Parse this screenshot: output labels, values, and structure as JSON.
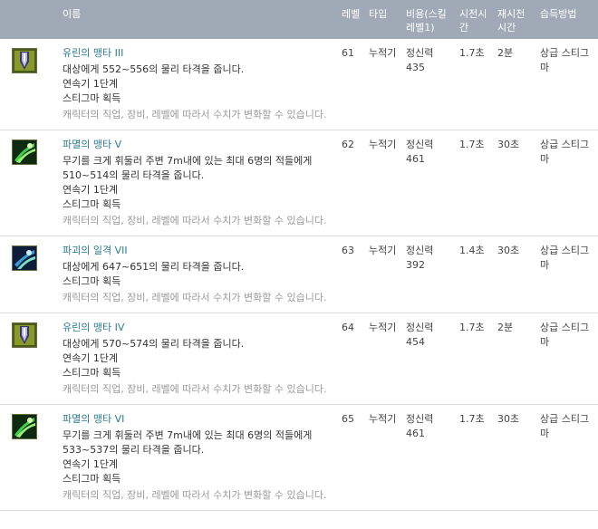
{
  "headers": {
    "name": "이름",
    "level": "레벨",
    "type": "타입",
    "cost": "비용(스킬 레벨1)",
    "cast": "시전시간",
    "cooldown": "재시전시간",
    "learn": "습득방법"
  },
  "colors": {
    "header_bg": "#a0a9b6",
    "skill_name": "#2c7a8e",
    "note": "#9a9a9a"
  },
  "skills": [
    {
      "icon": "lance-strike-icon",
      "name": "유린의 맹타 III",
      "lines": [
        "대상에게 552~556의 물리 타격을 줍니다.",
        "연속기 1단계",
        "스티그마 획득"
      ],
      "note": "캐릭터의 직업, 장비, 레벨에 따라서 수치가 변화할 수 있습니다.",
      "level": "61",
      "type": "누적기",
      "cost": "정신력 435",
      "cast": "1.7초",
      "cooldown": "2분",
      "learn": "상급 스티그마"
    },
    {
      "icon": "green-slash-icon",
      "name": "파멸의 맹타 V",
      "lines": [
        "무기를 크게 휘둘러 주변 7m내에 있는 최대 6명의 적들에게 510~514의 물리 타격을 줍니다.",
        "연속기 1단계",
        "스티그마 획득"
      ],
      "note": "캐릭터의 직업, 장비, 레벨에 따라서 수치가 변화할 수 있습니다.",
      "level": "62",
      "type": "누적기",
      "cost": "정신력 461",
      "cast": "1.7초",
      "cooldown": "30초",
      "learn": "상급 스티그마"
    },
    {
      "icon": "blue-slash-icon",
      "name": "파괴의 일격 VII",
      "lines": [
        "대상에게 647~651의 물리 타격을 줍니다.",
        "스티그마 획득"
      ],
      "note": "캐릭터의 직업, 장비, 레벨에 따라서 수치가 변화할 수 있습니다.",
      "level": "63",
      "type": "누적기",
      "cost": "정신력 392",
      "cast": "1.4초",
      "cooldown": "30초",
      "learn": "상급 스티그마"
    },
    {
      "icon": "lance-strike-icon",
      "name": "유린의 맹타 IV",
      "lines": [
        "대상에게 570~574의 물리 타격을 줍니다.",
        "연속기 1단계",
        "스티그마 획득"
      ],
      "note": "캐릭터의 직업, 장비, 레벨에 따라서 수치가 변화할 수 있습니다.",
      "level": "64",
      "type": "누적기",
      "cost": "정신력 454",
      "cast": "1.7초",
      "cooldown": "2분",
      "learn": "상급 스티그마"
    },
    {
      "icon": "green-slash-icon",
      "name": "파멸의 맹타 VI",
      "lines": [
        "무기를 크게 휘둘러 주변 7m내에 있는 최대 6명의 적들에게 533~537의 물리 타격을 줍니다.",
        "연속기 1단계",
        "스티그마 획득"
      ],
      "note": "캐릭터의 직업, 장비, 레벨에 따라서 수치가 변화할 수 있습니다.",
      "level": "65",
      "type": "누적기",
      "cost": "정신력 461",
      "cast": "1.7초",
      "cooldown": "30초",
      "learn": "상급 스티그마"
    }
  ]
}
